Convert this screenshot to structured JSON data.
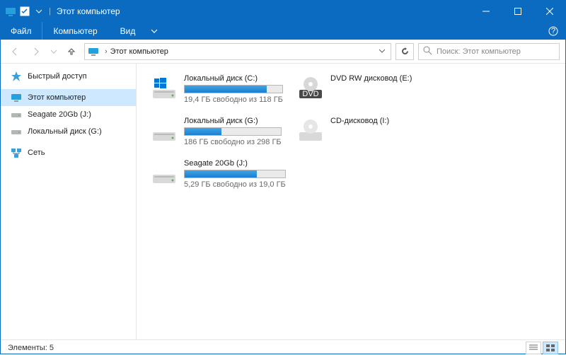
{
  "titlebar": {
    "title": "Этот компьютер"
  },
  "menubar": {
    "file": "Файл",
    "computer": "Компьютер",
    "view": "Вид"
  },
  "toolbar": {
    "breadcrumb": "Этот компьютер",
    "search_placeholder": "Поиск: Этот компьютер"
  },
  "sidebar": {
    "items": [
      {
        "label": "Быстрый доступ",
        "icon": "star"
      },
      {
        "label": "Этот компьютер",
        "icon": "pc",
        "selected": true
      },
      {
        "label": "Seagate 20Gb (J:)",
        "icon": "drive"
      },
      {
        "label": "Локальный диск (G:)",
        "icon": "drive"
      },
      {
        "label": "Сеть",
        "icon": "network"
      }
    ]
  },
  "drives": [
    {
      "name": "Локальный диск (C:)",
      "free": "19,4 ГБ свободно из 118 ГБ",
      "fill": 84,
      "type": "windows"
    },
    {
      "name": "DVD RW дисковод (E:)",
      "free": "",
      "fill": null,
      "type": "dvd"
    },
    {
      "name": "Локальный диск (G:)",
      "free": "186 ГБ свободно из 298 ГБ",
      "fill": 38,
      "type": "hdd"
    },
    {
      "name": "CD-дисковод (I:)",
      "free": "",
      "fill": null,
      "type": "cd"
    },
    {
      "name": "Seagate 20Gb (J:)",
      "free": "5,29 ГБ свободно из 19,0 ГБ",
      "fill": 72,
      "type": "hdd"
    },
    {
      "name": "",
      "free": "",
      "fill": null,
      "type": ""
    }
  ],
  "statusbar": {
    "text": "Элементы: 5"
  }
}
